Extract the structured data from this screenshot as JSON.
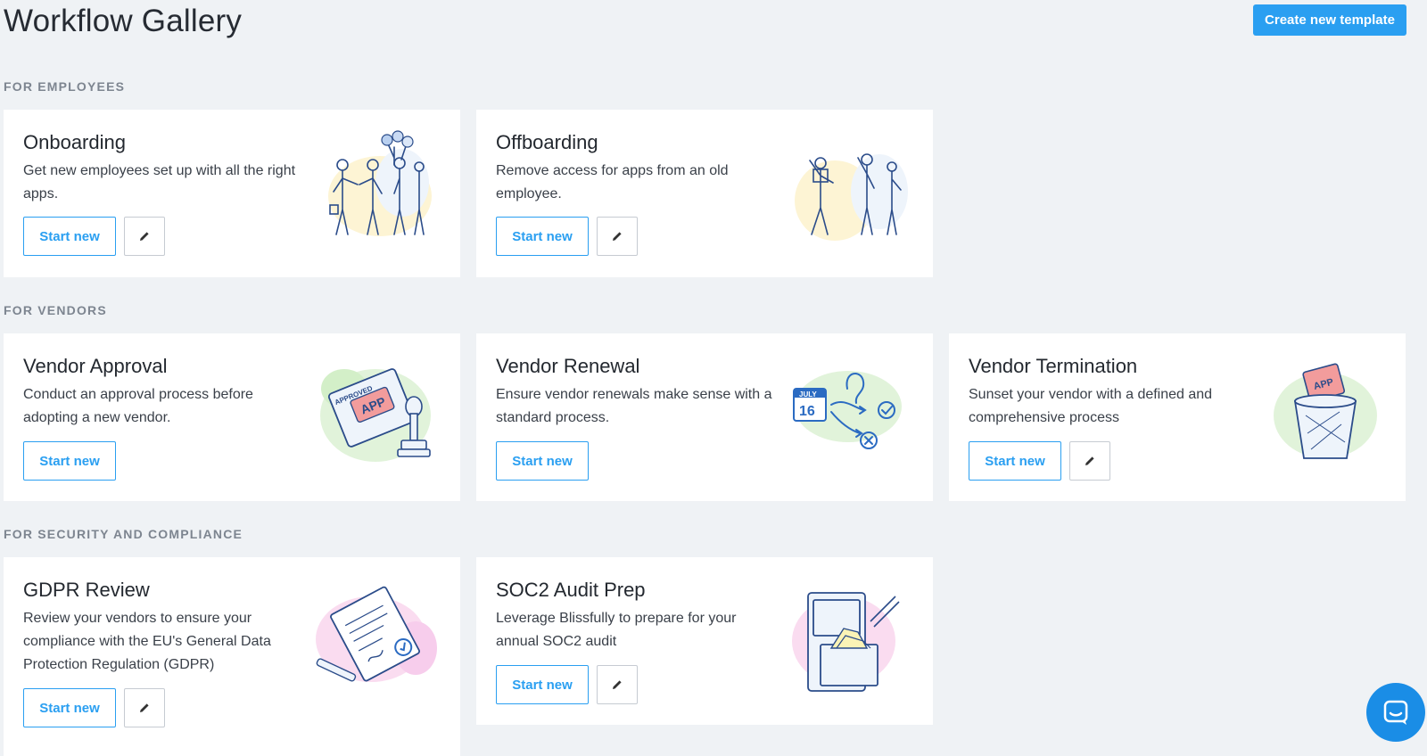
{
  "header": {
    "title": "Workflow Gallery",
    "create_label": "Create new template"
  },
  "sections": [
    {
      "label": "FOR EMPLOYEES",
      "cards": [
        {
          "title": "Onboarding",
          "description": "Get new employees set up with all the right apps.",
          "start_label": "Start new",
          "has_edit": true,
          "illustration": "handshake-people-illustration"
        },
        {
          "title": "Offboarding",
          "description": "Remove access for apps from an old employee.",
          "start_label": "Start new",
          "has_edit": true,
          "illustration": "waving-people-illustration"
        }
      ]
    },
    {
      "label": "FOR VENDORS",
      "cards": [
        {
          "title": "Vendor Approval",
          "description": "Conduct an approval process before adopting a new vendor.",
          "start_label": "Start new",
          "has_edit": false,
          "illustration": "approved-stamp-illustration",
          "illustration_text": [
            "APPROVED",
            "APP"
          ]
        },
        {
          "title": "Vendor Renewal",
          "description": "Ensure vendor renewals make sense with a standard process.",
          "start_label": "Start new",
          "has_edit": false,
          "illustration": "calendar-decision-illustration",
          "illustration_text": [
            "JULY",
            "16"
          ]
        },
        {
          "title": "Vendor Termination",
          "description": "Sunset your vendor with a defined and comprehensive process",
          "start_label": "Start new",
          "has_edit": true,
          "illustration": "trash-bin-illustration",
          "illustration_text": [
            "APP"
          ]
        }
      ]
    },
    {
      "label": "FOR SECURITY AND COMPLIANCE",
      "cards": [
        {
          "title": "GDPR Review",
          "description": "Review your vendors to ensure your compliance with the EU's General Data Protection Regulation (GDPR)",
          "start_label": "Start new",
          "has_edit": true,
          "illustration": "signed-document-illustration"
        },
        {
          "title": "SOC2 Audit Prep",
          "description": "Leverage Blissfully to prepare for your annual SOC2 audit",
          "start_label": "Start new",
          "has_edit": true,
          "illustration": "file-cabinet-illustration"
        }
      ]
    }
  ],
  "colors": {
    "accent": "#2a9ff1",
    "background": "#eff2f5",
    "card": "#ffffff",
    "chat": "#1a8de6"
  },
  "icons": {
    "edit": "pencil-icon",
    "chat": "chat-icon"
  }
}
